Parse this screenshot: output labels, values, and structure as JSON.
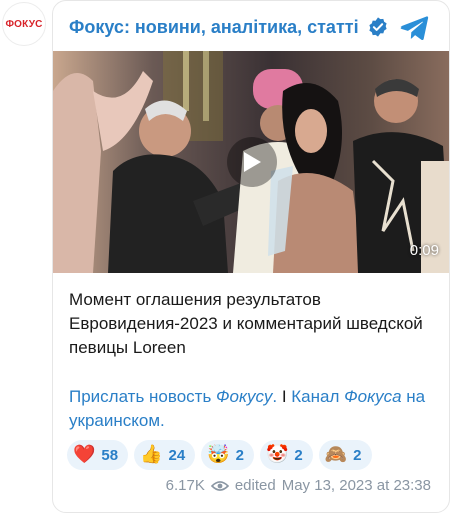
{
  "avatar": {
    "label": "ФОКУС"
  },
  "channel": {
    "name": "Фокус: новини, аналітика, статті"
  },
  "media": {
    "duration": "0:09"
  },
  "post": {
    "text": "Момент оглашения результатов Евровидения-2023 и комментарий шведской певицы Loreen",
    "link1_part1": "Прислать новость ",
    "link1_part2": "Фокусу",
    "link1_part3": ".",
    "separator": " I ",
    "link2_part1": "Канал ",
    "link2_part2": "Фокуса",
    "link2_part3": " на украинском."
  },
  "reactions": [
    {
      "icon": "heart",
      "emoji": "❤️",
      "count": "58"
    },
    {
      "icon": "thumbs-up",
      "emoji": "👍",
      "count": "24"
    },
    {
      "icon": "exploding-head",
      "emoji": "🤯",
      "count": "2"
    },
    {
      "icon": "clown-face",
      "emoji": "🤡",
      "count": "2"
    },
    {
      "icon": "see-no-evil-monkey",
      "emoji": "🙈",
      "count": "2"
    }
  ],
  "meta": {
    "views": "6.17K",
    "edited": "edited",
    "date": "May 13, 2023 at 23:38"
  },
  "colors": {
    "accent": "#2a7fc7",
    "reaction_bg": "#eaf3fb",
    "logo_red": "#d8232a",
    "meta_gray": "#8a96a3"
  }
}
